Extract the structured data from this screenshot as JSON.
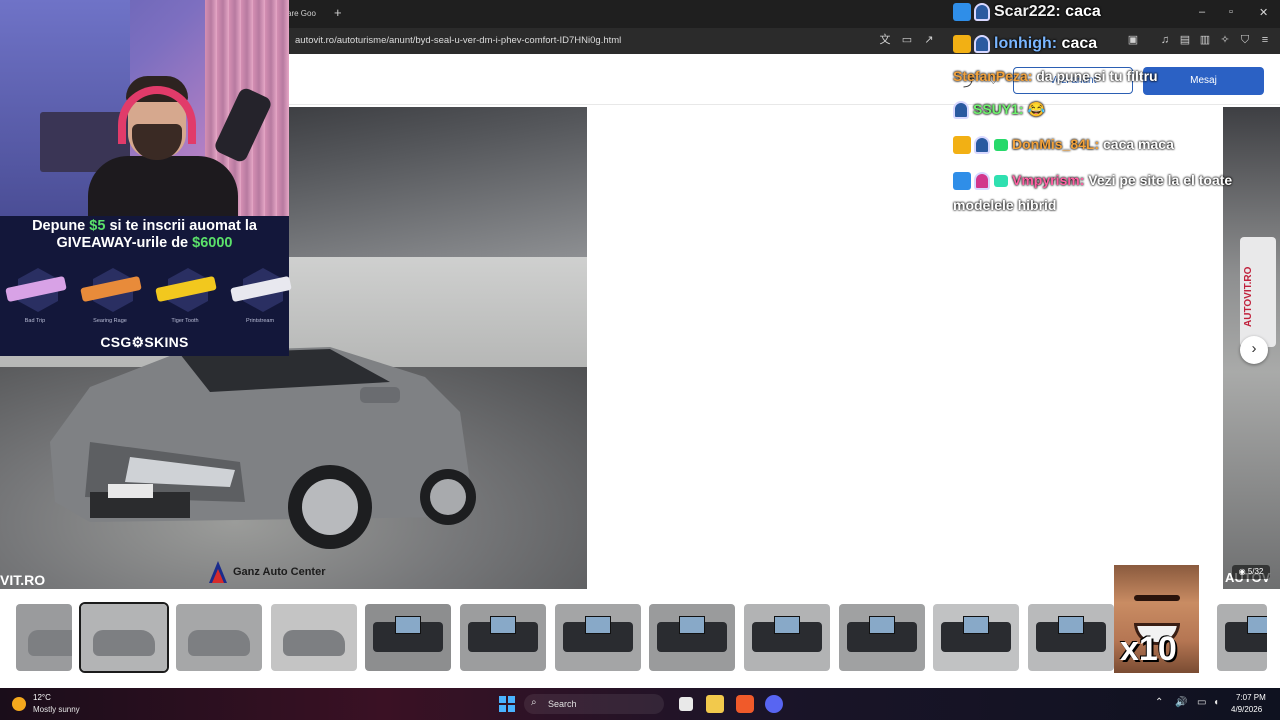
{
  "browser": {
    "tab_fragment": "zare Goo",
    "new_tab_symbol": "+",
    "url": "autovit.ro/autoturisme/anunt/byd-seal-u-ver-dm-i-phev-comfort-ID7HNi0g.html",
    "window_controls": [
      "–",
      "▫",
      "✕"
    ]
  },
  "listing": {
    "header_buttons": {
      "outline_label": "Vezi anunt",
      "solid_label": "Mesaj"
    },
    "photo": {
      "watermark": "VIT.RO",
      "dealer_name": "Ganz Auto Center",
      "counter": "5/32",
      "right_watermark": "AUTOV",
      "banner_text": "AUTOVIT.RO"
    },
    "next_arrow": "›",
    "thumbnails": [
      {
        "kind": "exterior",
        "bg": "#9a9b9d"
      },
      {
        "kind": "exterior",
        "bg": "#b3b4b5",
        "selected": true
      },
      {
        "kind": "exterior",
        "bg": "#a6a7a8"
      },
      {
        "kind": "exterior",
        "bg": "#c4c4c4"
      },
      {
        "kind": "interior",
        "bg": "#8d8e8f"
      },
      {
        "kind": "interior",
        "bg": "#9c9d9e"
      },
      {
        "kind": "interior",
        "bg": "#a4a5a6"
      },
      {
        "kind": "interior",
        "bg": "#9a9b9c"
      },
      {
        "kind": "interior",
        "bg": "#b2b3b4"
      },
      {
        "kind": "interior",
        "bg": "#a0a1a2"
      },
      {
        "kind": "interior",
        "bg": "#c1c2c3"
      },
      {
        "kind": "interior",
        "bg": "#b9babb"
      },
      {
        "kind": "interior",
        "bg": "#aeafb0"
      }
    ]
  },
  "stream_overlay": {
    "promo": {
      "line1_prefix": "Depune ",
      "line1_amount": "$5",
      "line1_suffix": " si te inscrii auomat la",
      "line2_prefix": "GIVEAWAY-urile de ",
      "line2_amount": "$6000"
    },
    "skins": [
      {
        "name": "Bad Trip",
        "color": "#d8a2e6"
      },
      {
        "name": "Searing Rage",
        "color": "#e88b3a"
      },
      {
        "name": "Tiger Tooth",
        "color": "#f2c81e"
      },
      {
        "name": "Printstream",
        "color": "#e8e8ef"
      }
    ],
    "brand": "CSG⚙SKINS",
    "chat": [
      {
        "user": "Scar222:",
        "message": "caca",
        "user_color": "#f2f2f2",
        "badge_color": "#2f8ee8"
      },
      {
        "user": "lonhigh:",
        "message": "caca",
        "user_color": "#7ab6ff",
        "badge_color": "#f2b014"
      },
      {
        "user": "StefanPeza:",
        "message": "da pune si tu filtru",
        "user_color": "#f2a23c"
      },
      {
        "user": "SSUY1:",
        "message": "😂",
        "user_color": "#6ef26e"
      },
      {
        "user": "DonMis_84L:",
        "message": "caca maca",
        "user_color": "#f2a23c",
        "badge_color": "#f2b014"
      },
      {
        "user": "Vmpyrism:",
        "message": "Vezi pe site la el toate modelele hibrid",
        "user_color": "#ff5fa2",
        "badge_color": "#2f8ee8"
      }
    ],
    "meme_text": "x10"
  },
  "taskbar": {
    "weather_temp": "12°C",
    "weather_desc": "Mostly sunny",
    "search_label": "Search",
    "time": "7:07 PM",
    "date": "4/9/2026"
  }
}
